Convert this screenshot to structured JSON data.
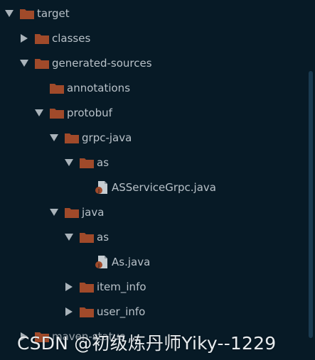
{
  "colors": {
    "background": "#071a26",
    "folder": "#a04a2a",
    "arrow": "#a9b3ba",
    "text": "#b8c1c8"
  },
  "tree": [
    {
      "label": "target",
      "expanded": true,
      "icon": "folder-icon"
    },
    {
      "label": "classes",
      "expanded": false,
      "icon": "folder-icon"
    },
    {
      "label": "generated-sources",
      "expanded": true,
      "icon": "folder-icon"
    },
    {
      "label": "annotations",
      "expanded": null,
      "icon": "folder-icon"
    },
    {
      "label": "protobuf",
      "expanded": true,
      "icon": "folder-icon"
    },
    {
      "label": "grpc-java",
      "expanded": true,
      "icon": "folder-icon"
    },
    {
      "label": "as",
      "expanded": true,
      "icon": "folder-icon"
    },
    {
      "label": "ASServiceGrpc.java",
      "expanded": null,
      "icon": "java-file-icon"
    },
    {
      "label": "java",
      "expanded": true,
      "icon": "folder-icon"
    },
    {
      "label": "as",
      "expanded": true,
      "icon": "folder-icon"
    },
    {
      "label": "As.java",
      "expanded": null,
      "icon": "java-file-icon"
    },
    {
      "label": "item_info",
      "expanded": false,
      "icon": "folder-icon"
    },
    {
      "label": "user_info",
      "expanded": false,
      "icon": "folder-icon"
    },
    {
      "label": "maven-status",
      "expanded": false,
      "icon": "folder-icon"
    }
  ],
  "watermark": "CSDN @初级炼丹师Yiky--1229"
}
